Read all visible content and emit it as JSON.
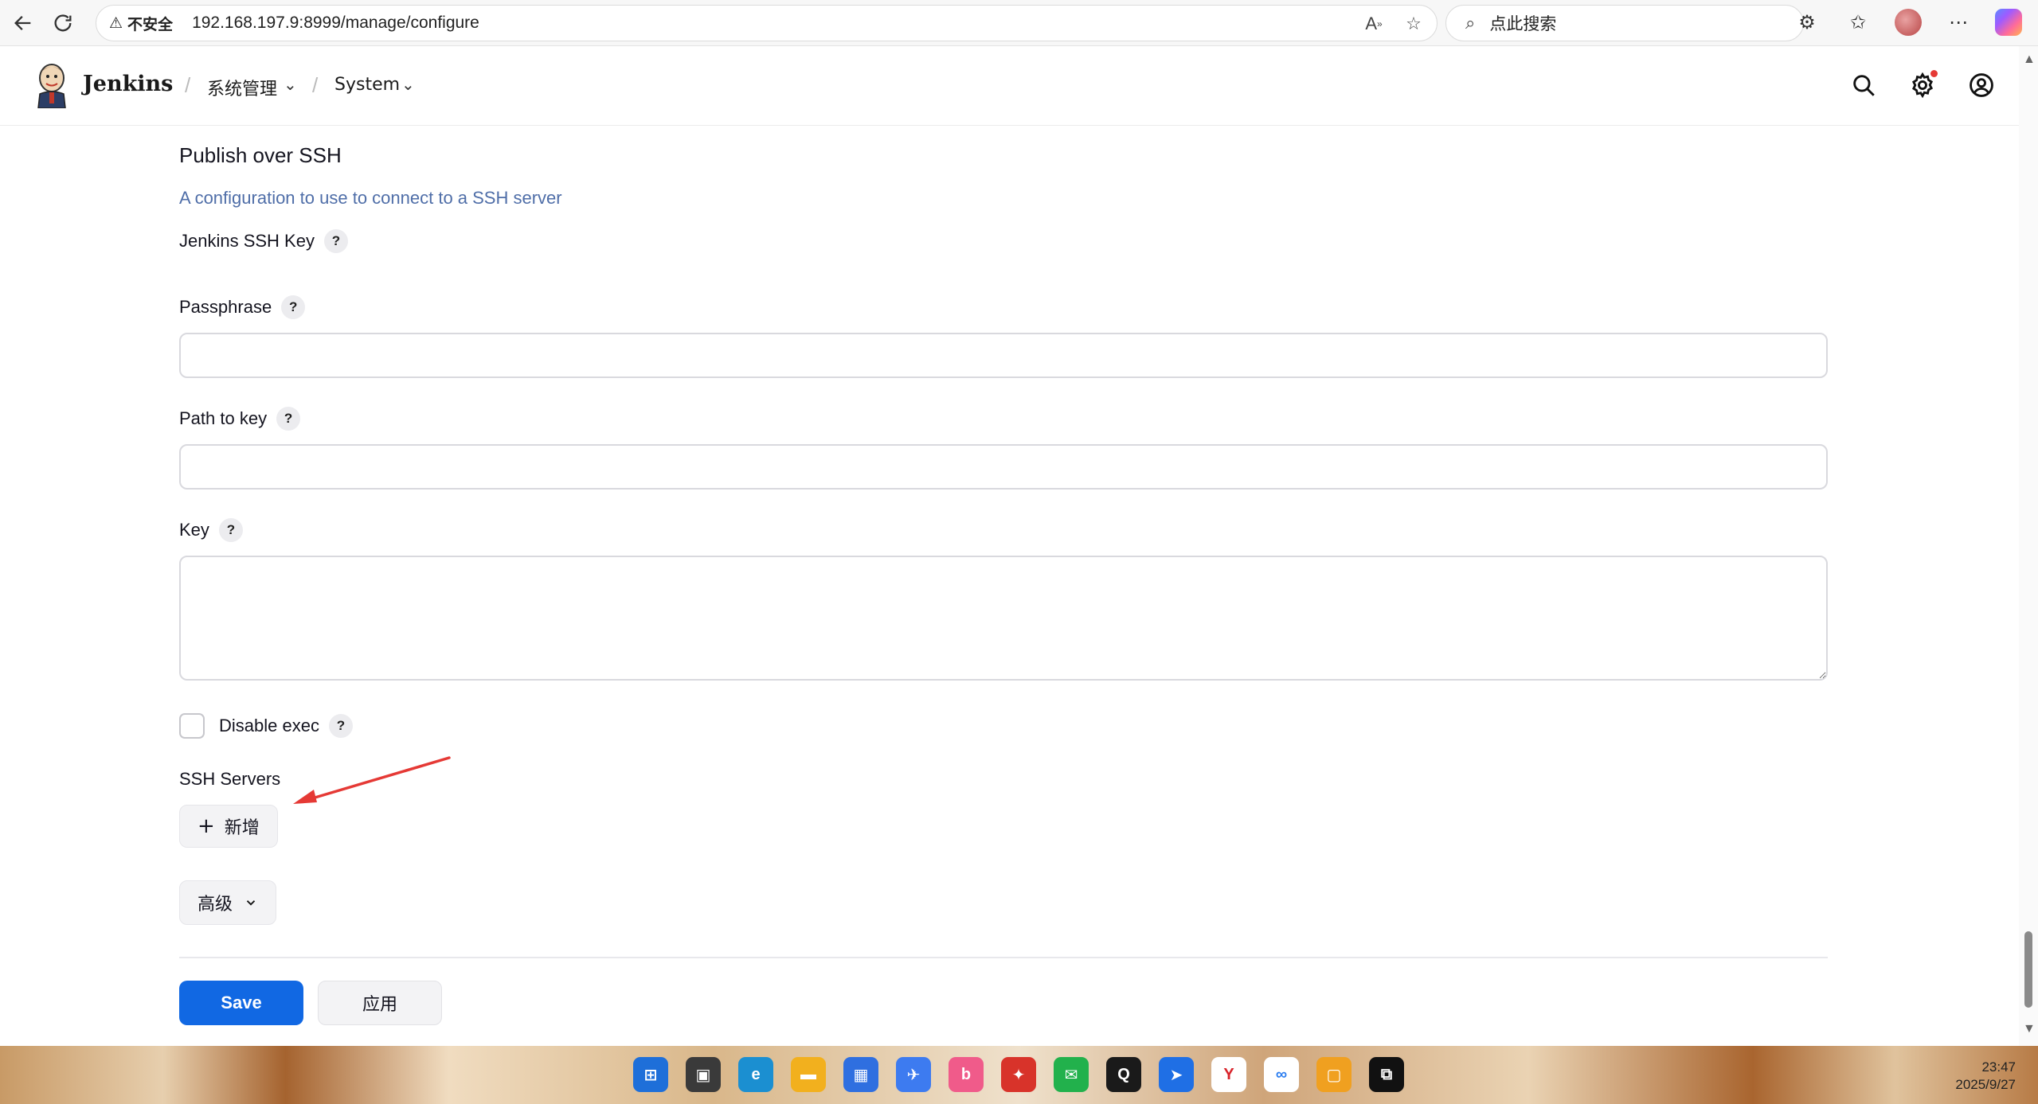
{
  "browser": {
    "insecure_label": "不安全",
    "url": "192.168.197.9:8999/manage/configure",
    "search_placeholder": "点此搜索"
  },
  "header": {
    "brand": "Jenkins",
    "breadcrumbs": [
      {
        "label": "系统管理"
      },
      {
        "label": "System"
      }
    ]
  },
  "section": {
    "title": "Publish over SSH",
    "description": "A configuration to use to connect to a SSH server"
  },
  "fields": {
    "jenkins_ssh_key_label": "Jenkins SSH Key",
    "passphrase_label": "Passphrase",
    "passphrase_value": "",
    "path_to_key_label": "Path to key",
    "path_to_key_value": "",
    "key_label": "Key",
    "key_value": "",
    "disable_exec_label": "Disable exec",
    "disable_exec_checked": false,
    "ssh_servers_label": "SSH Servers",
    "help_glyph": "?"
  },
  "buttons": {
    "add_label": "新增",
    "advanced_label": "高级",
    "save_label": "Save",
    "apply_label": "应用"
  },
  "taskbar": {
    "time": "23:47",
    "date": "2025/9/27"
  },
  "colors": {
    "accent": "#1168e3",
    "link": "#4f6ea8",
    "annotation_arrow": "#e53935"
  }
}
